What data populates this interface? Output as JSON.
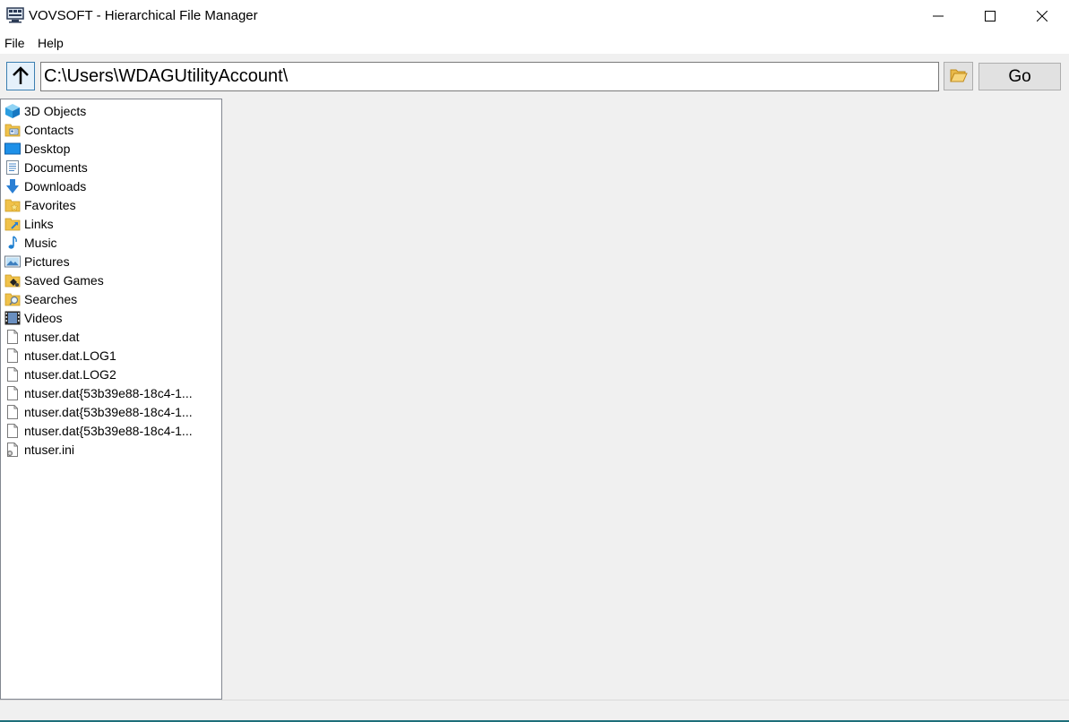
{
  "window": {
    "title": "VOVSOFT - Hierarchical File Manager",
    "minimize_icon": "minimize-icon",
    "maximize_icon": "maximize-icon",
    "close_icon": "close-icon"
  },
  "menu": {
    "items": [
      "File",
      "Help"
    ]
  },
  "toolbar": {
    "path_value": "C:\\Users\\WDAGUtilityAccount\\",
    "go_label": "Go",
    "up_icon": "arrow-up-icon",
    "browse_icon": "folder-open-icon"
  },
  "tree": {
    "items": [
      {
        "label": "3D Objects",
        "icon": "3d-objects-icon"
      },
      {
        "label": "Contacts",
        "icon": "contacts-icon"
      },
      {
        "label": "Desktop",
        "icon": "desktop-icon"
      },
      {
        "label": "Documents",
        "icon": "documents-icon"
      },
      {
        "label": "Downloads",
        "icon": "downloads-icon"
      },
      {
        "label": "Favorites",
        "icon": "favorites-icon"
      },
      {
        "label": "Links",
        "icon": "links-icon"
      },
      {
        "label": "Music",
        "icon": "music-icon"
      },
      {
        "label": "Pictures",
        "icon": "pictures-icon"
      },
      {
        "label": "Saved Games",
        "icon": "saved-games-icon"
      },
      {
        "label": "Searches",
        "icon": "searches-icon"
      },
      {
        "label": "Videos",
        "icon": "videos-icon"
      },
      {
        "label": "ntuser.dat",
        "icon": "file-icon"
      },
      {
        "label": "ntuser.dat.LOG1",
        "icon": "file-icon"
      },
      {
        "label": "ntuser.dat.LOG2",
        "icon": "file-icon"
      },
      {
        "label": "ntuser.dat{53b39e88-18c4-1...",
        "icon": "file-icon"
      },
      {
        "label": "ntuser.dat{53b39e88-18c4-1...",
        "icon": "file-icon"
      },
      {
        "label": "ntuser.dat{53b39e88-18c4-1...",
        "icon": "file-icon"
      },
      {
        "label": "ntuser.ini",
        "icon": "settings-file-icon"
      }
    ]
  },
  "colors": {
    "accent": "#3c7fb1",
    "folder_yellow": "#f0c24a",
    "status_line": "#1e6f7a"
  }
}
